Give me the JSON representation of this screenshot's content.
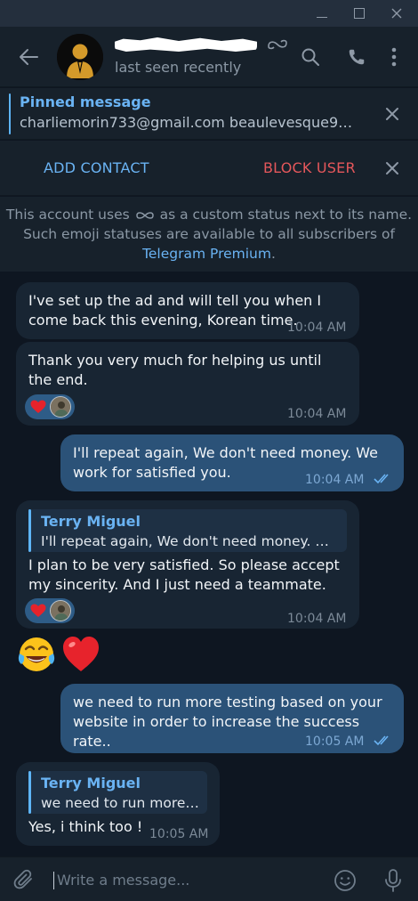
{
  "header": {
    "status": "last seen recently"
  },
  "pinned": {
    "title": "Pinned message",
    "text": "charliemorin733@gmail.com beaulevesque9@g..."
  },
  "actions": {
    "add_contact": "ADD CONTACT",
    "block_user": "BLOCK USER"
  },
  "info": {
    "part1": "This account uses",
    "part2": "as a custom status next to its name. Such emoji statuses are available to all subscribers of",
    "link": "Telegram Premium",
    "part3": "."
  },
  "messages": [
    {
      "direction": "in",
      "text": "I've set up the ad and will tell you when I come back this evening, Korean time.",
      "time": "10:04 AM"
    },
    {
      "direction": "in",
      "text": "Thank you very much for helping us until the end.",
      "time": "10:04 AM",
      "reaction": "heart-icon"
    },
    {
      "direction": "out",
      "text": "I'll repeat again, We don't need money. We work for satisfied you.",
      "time": "10:04 AM",
      "read": true
    },
    {
      "direction": "in",
      "reply_name": "Terry Miguel",
      "reply_text": "I'll repeat again, We don't need money. We...",
      "text": "I plan to be very satisfied. So please accept my sincerity. And I just need a teammate.",
      "time": "10:04 AM",
      "reaction": "heart-icon"
    },
    {
      "direction": "in",
      "emoji": [
        "tears-of-joy-emoji",
        "red-heart-emoji"
      ]
    },
    {
      "direction": "out",
      "text": "we need to run more testing based on your website in order to increase the success rate..",
      "time": "10:05 AM",
      "read": true
    },
    {
      "direction": "in",
      "reply_name": "Terry Miguel",
      "reply_text": "we need to run more ...",
      "text": "Yes, i think too !",
      "time": "10:05 AM"
    }
  ],
  "composer": {
    "placeholder": "Write a message..."
  },
  "colors": {
    "background": "#0e1621",
    "panel": "#17212b",
    "incoming": "#182533",
    "outgoing": "#2b5278",
    "accent": "#6ab3f3",
    "danger": "#e5575b"
  }
}
